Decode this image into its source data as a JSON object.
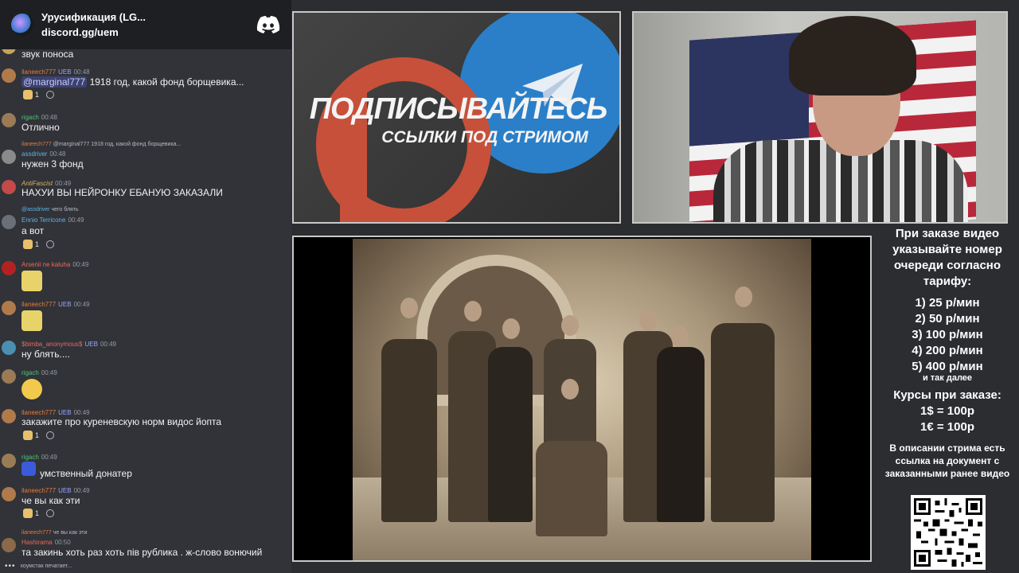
{
  "chat": {
    "server_name": "Урусификация (LG...",
    "invite": "discord.gg/uem",
    "typing_user": "хоумстак печатает...",
    "messages": [
      {
        "text": "звук поноса"
      },
      {
        "username": "ilaneech777",
        "badge": "UEB",
        "time": "00:48",
        "mention": "@marginal777",
        "text": "1918 год, какой фонд борщевика...",
        "reaction_count": "1"
      },
      {
        "username": "rigach",
        "time": "00:48",
        "text": "Отлично"
      },
      {
        "reply_user": "ilaneech777",
        "reply_text": "@marginal777 1918 год, какой фонд борщевика...",
        "username": "assdriver",
        "time": "00:48",
        "text": "нужен 3 фонд"
      },
      {
        "username": "AntiFascist",
        "time": "00:49",
        "text": "НАХУИ ВЫ НЕЙРОНКУ ЕБАНУЮ ЗАКАЗАЛИ"
      },
      {
        "reply_user": "@assdriver",
        "reply_text": "чего блять",
        "username": "Ennio Terricone",
        "time": "00:49",
        "text": "а вот",
        "reaction_count": "1"
      },
      {
        "username": "Arsenii ne kaluha",
        "time": "00:49"
      },
      {
        "username": "ilaneech777",
        "badge": "UEB",
        "time": "00:49"
      },
      {
        "username": "$bimba_anonymous$",
        "badge": "UEB",
        "time": "00:49",
        "text": "ну блять...."
      },
      {
        "username": "rigach",
        "time": "00:49"
      },
      {
        "username": "ilaneech777",
        "badge": "UEB",
        "time": "00:49",
        "text": "закажите про куреневскую норм видос йопта",
        "reaction_count": "1"
      },
      {
        "username": "rigach",
        "time": "00:49",
        "text": "умственный донатер"
      },
      {
        "username": "ilaneech777",
        "badge": "UEB",
        "time": "00:49",
        "text": "че вы как эти",
        "reaction_count": "1"
      },
      {
        "reply_user": "ilaneech777",
        "reply_text": "че вы как эти",
        "username": "Hashirama",
        "time": "00:50",
        "text": "та закинь хоть раз хоть пів рублика . ж-слово вонючий"
      }
    ]
  },
  "promo": {
    "title": "ПОДПИСЫВАЙТЕСЬ",
    "subtitle": "ССЫЛКИ ПОД СТРИМОМ"
  },
  "info": {
    "order_note": "При заказе видео указывайте номер очереди согласно тарифу:",
    "tariffs": [
      "1) 25 р/мин",
      "2) 50 р/мин",
      "3) 100 р/мин",
      "4) 200 р/мин",
      "5) 400 р/мин"
    ],
    "more": "и так далее",
    "rates_title": "Курсы при заказе:",
    "rates": [
      "1$ = 100р",
      "1€ = 100р"
    ],
    "description": "В описании стрима есть ссылка на документ с заказанными ранее видео"
  },
  "colors": {
    "patreon": "#c7503a",
    "telegram": "#2a7fc8",
    "discord_bg": "#313338"
  }
}
